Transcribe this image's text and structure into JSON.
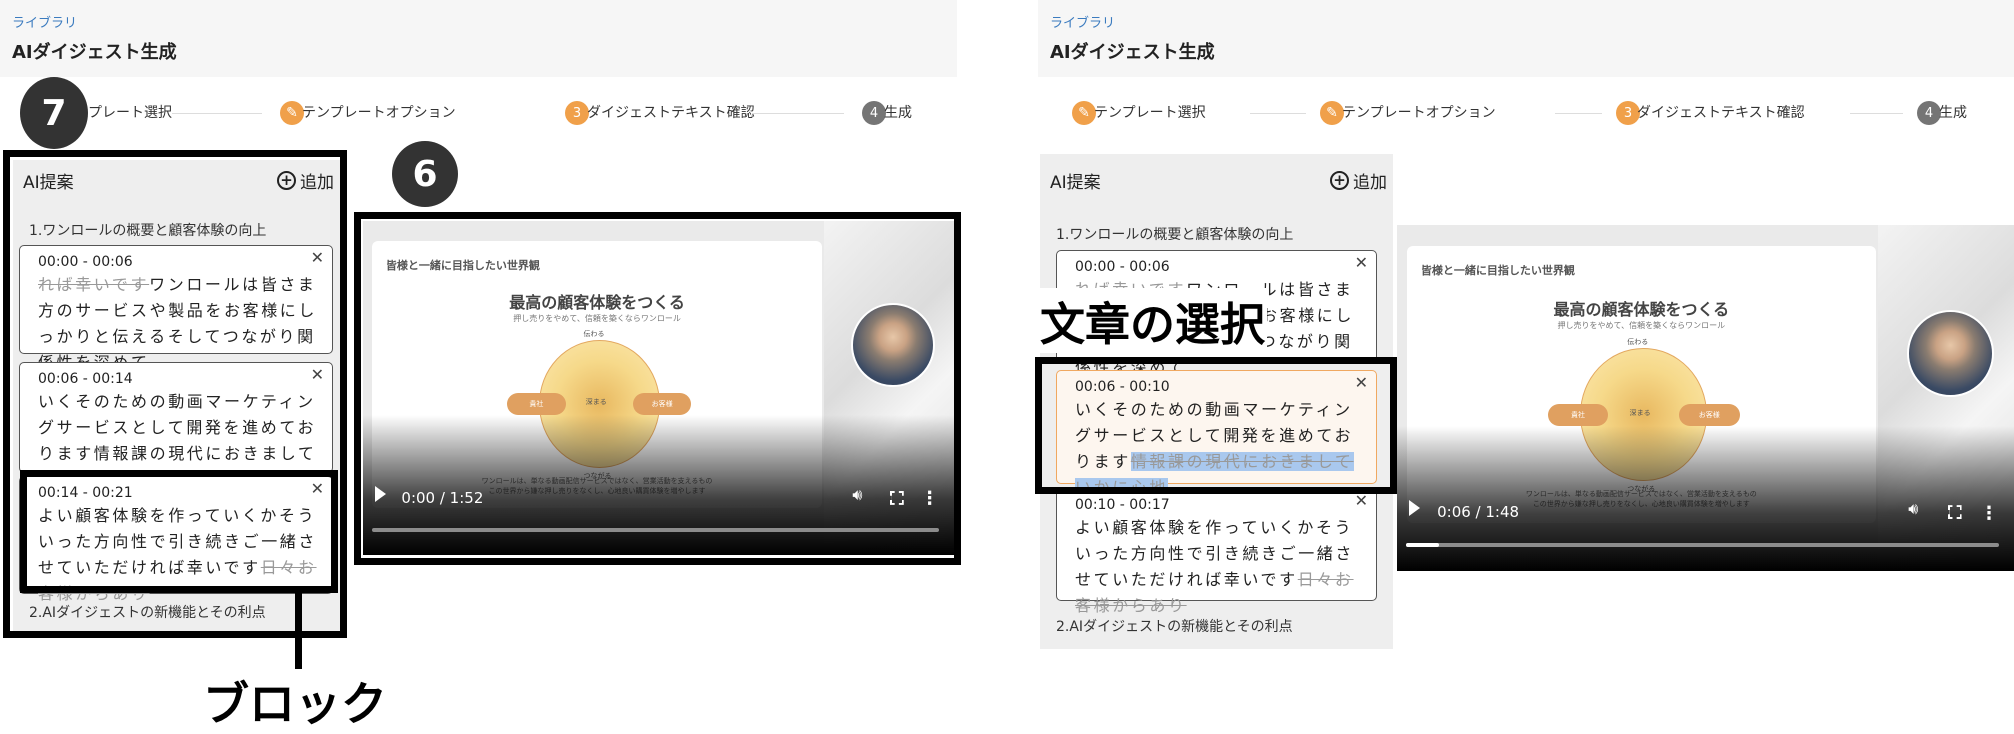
{
  "colors": {
    "accent": "#f0a04a",
    "link": "#3b7bbf",
    "pending_step": "#757575",
    "selection": "#a9c8ee"
  },
  "screens": [
    {
      "header": {
        "breadcrumb": "ライブラリ",
        "title": "AIダイジェスト生成"
      },
      "steps": [
        {
          "label": "テンプレート選択",
          "state": "done",
          "icon": "pencil-icon",
          "num": ""
        },
        {
          "label": "テンプレートオプション",
          "state": "done",
          "icon": "pencil-icon",
          "num": ""
        },
        {
          "label": "ダイジェストテキスト確認",
          "state": "active",
          "icon": "",
          "num": "3"
        },
        {
          "label": "生成",
          "state": "todo",
          "icon": "",
          "num": "4"
        }
      ],
      "panel": {
        "title": "AI提案",
        "add_label": "追加",
        "section1": "1.ワンロールの概要と顧客体験の向上",
        "section2": "2.AIダイジェストの新機能とその利点",
        "cards": [
          {
            "time": "00:00 - 00:06",
            "selected": false,
            "segments": [
              {
                "text": "れば幸いです",
                "struck": true
              },
              {
                "text": "ワンロールは皆さま方のサービスや製品をお客様にしっかりと伝えるそしてつながり関係性を深めて"
              }
            ]
          },
          {
            "time": "00:06 - 00:14",
            "selected": false,
            "segments": [
              {
                "text": "いくそのための動画マーケティングサービスとして開発を進めております情報課の現代におきましていかに心地"
              }
            ]
          },
          {
            "time": "00:14 - 00:21",
            "selected": false,
            "segments": [
              {
                "text": "よい顧客体験を作っていくかそういった方向性で引き続きご一緒させていただければ幸いです"
              },
              {
                "text": "日々お客様からあり",
                "struck": true
              }
            ]
          }
        ]
      },
      "video": {
        "time": "0:00 / 1:52",
        "progress": 0.0
      }
    },
    {
      "header": {
        "breadcrumb": "ライブラリ",
        "title": "AIダイジェスト生成"
      },
      "steps": [
        {
          "label": "テンプレート選択",
          "state": "done",
          "icon": "pencil-icon",
          "num": ""
        },
        {
          "label": "テンプレートオプション",
          "state": "done",
          "icon": "pencil-icon",
          "num": ""
        },
        {
          "label": "ダイジェストテキスト確認",
          "state": "active",
          "icon": "",
          "num": "3"
        },
        {
          "label": "生成",
          "state": "todo",
          "icon": "",
          "num": "4"
        }
      ],
      "panel": {
        "title": "AI提案",
        "add_label": "追加",
        "section1": "1.ワンロールの概要と顧客体験の向上",
        "section2": "2.AIダイジェストの新機能とその利点",
        "cards": [
          {
            "time": "00:00 - 00:06",
            "selected": false,
            "segments": [
              {
                "text": "れば幸いです",
                "struck": true
              },
              {
                "text": "ワンロールは皆さま方のサービスや製品をお客様にしっかりと伝えるそしてつながり関係性を深めて"
              }
            ]
          },
          {
            "time": "00:06 - 00:10",
            "selected": true,
            "segments": [
              {
                "text": "いくそのための動画マーケティングサービスとして開発を進めております"
              },
              {
                "text": "情報課の現代におきましていかに心地",
                "struck": true,
                "highlighted": true
              }
            ]
          },
          {
            "time": "00:10 - 00:17",
            "selected": false,
            "segments": [
              {
                "text": "よい顧客体験を作っていくかそういった方向性で引き続きご一緒させていただければ幸いです"
              },
              {
                "text": "日々お客様からあり",
                "struck": true
              }
            ]
          }
        ]
      },
      "video": {
        "time": "0:06 / 1:48",
        "progress": 0.0556
      }
    }
  ],
  "slide": {
    "heading": "皆様と一緒に目指したい世界観",
    "title": "最高の顧客体験をつくる",
    "subtitle": "押し売りをやめて、信頼を築くならワンロール",
    "top": "伝わる",
    "center": "深まる",
    "left": "貴社",
    "right": "お客様",
    "bottom": "つながる",
    "footer1": "ワンロールは、単なる動画配信サービスではなく、営業活動を支えるもの",
    "footer2": "この世界から嫌な押し売りをなくし、心地良い購買体験を増やします"
  },
  "annotations": {
    "badge_7": "7",
    "badge_6": "6",
    "block_label": "ブロック",
    "selection_label": "文章の選択"
  }
}
